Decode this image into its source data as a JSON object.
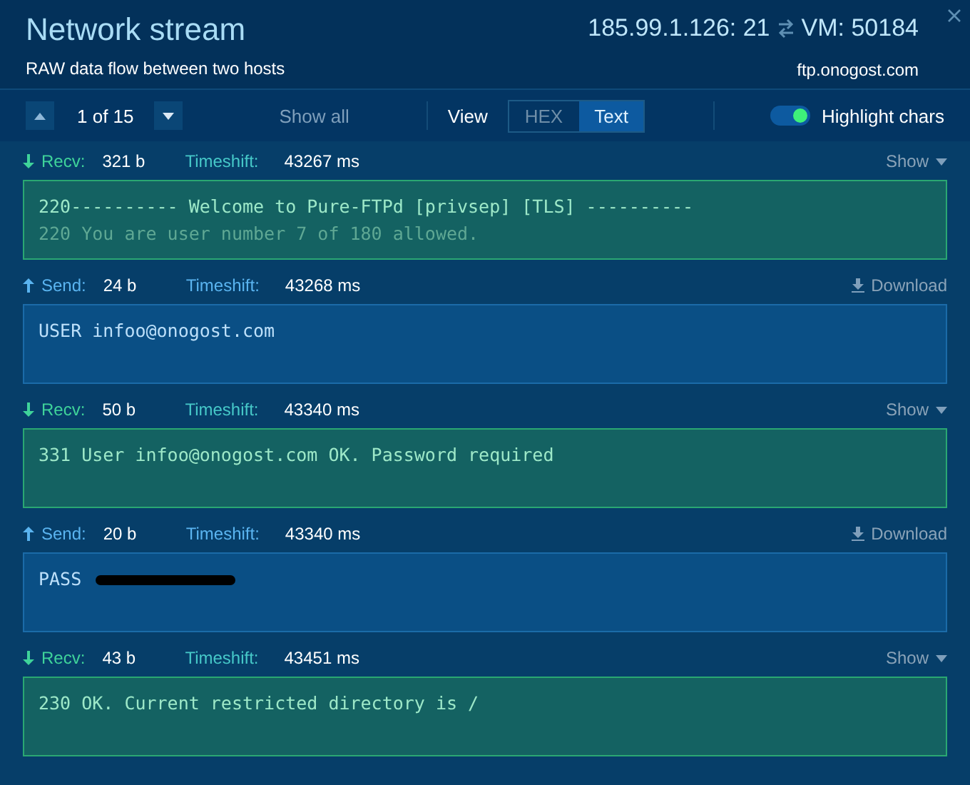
{
  "header": {
    "title": "Network stream",
    "subtitle": "RAW data flow between two hosts",
    "endpoint_a": "185.99.1.126: 21",
    "endpoint_b": "VM: 50184",
    "host": "ftp.onogost.com"
  },
  "toolbar": {
    "counter": "1 of 15",
    "show_all": "Show all",
    "view_label": "View",
    "view_options": [
      {
        "label": "HEX",
        "selected": false
      },
      {
        "label": "Text",
        "selected": true
      }
    ],
    "highlight": {
      "label": "Highlight chars",
      "on": true
    }
  },
  "packets": [
    {
      "kind": "recv",
      "direction": "Recv:",
      "size": "321 b",
      "timeshift_label": "Timeshift:",
      "timeshift": "43267 ms",
      "action": "Show",
      "lines": [
        {
          "text": "220---------- Welcome to Pure-FTPd [privsep] [TLS] ----------",
          "dim": false
        },
        {
          "text": "220 You are user number 7 of 180 allowed.",
          "dim": true
        }
      ]
    },
    {
      "kind": "send",
      "direction": "Send:",
      "size": "24 b",
      "timeshift_label": "Timeshift:",
      "timeshift": "43268 ms",
      "action": "Download",
      "lines": [
        {
          "text": "USER infoo@onogost.com",
          "dim": false
        }
      ]
    },
    {
      "kind": "recv",
      "direction": "Recv:",
      "size": "50 b",
      "timeshift_label": "Timeshift:",
      "timeshift": "43340 ms",
      "action": "Show",
      "lines": [
        {
          "text": "331 User infoo@onogost.com OK. Password required",
          "dim": false
        }
      ]
    },
    {
      "kind": "send",
      "direction": "Send:",
      "size": "20 b",
      "timeshift_label": "Timeshift:",
      "timeshift": "43340 ms",
      "action": "Download",
      "redacted": true,
      "lines": [
        {
          "text": "PASS",
          "dim": false
        }
      ]
    },
    {
      "kind": "recv",
      "direction": "Recv:",
      "size": "43 b",
      "timeshift_label": "Timeshift:",
      "timeshift": "43451 ms",
      "action": "Show",
      "lines": [
        {
          "text": "230 OK. Current restricted directory is /",
          "dim": false
        }
      ]
    }
  ]
}
